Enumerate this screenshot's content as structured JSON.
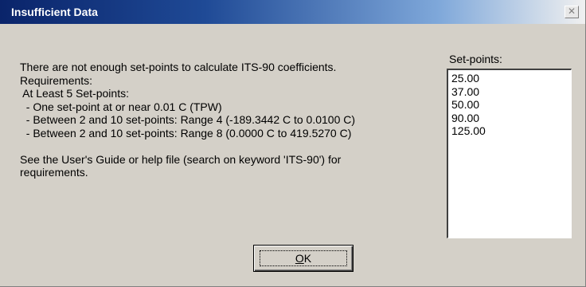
{
  "window": {
    "title": "Insufficient Data",
    "close_icon": "close-icon"
  },
  "message": {
    "lines": [
      "There are not enough set-points to calculate ITS-90 coefficients.",
      "Requirements:",
      " At Least 5 Set-points:",
      "  - One set-point at or near 0.01 C (TPW)",
      "  - Between 2 and 10 set-points: Range 4 (-189.3442 C to 0.0100 C)",
      "  - Between 2 and 10 set-points: Range 8 (0.0000 C to 419.5270 C)"
    ],
    "footer_lines": [
      "See the User's Guide or help file (search on keyword 'ITS-90') for",
      "requirements."
    ]
  },
  "setpoints": {
    "label": "Set-points:",
    "items": [
      "25.00",
      "37.00",
      "50.00",
      "90.00",
      "125.00"
    ]
  },
  "ok_button": {
    "mnemonic": "O",
    "rest": "K"
  }
}
